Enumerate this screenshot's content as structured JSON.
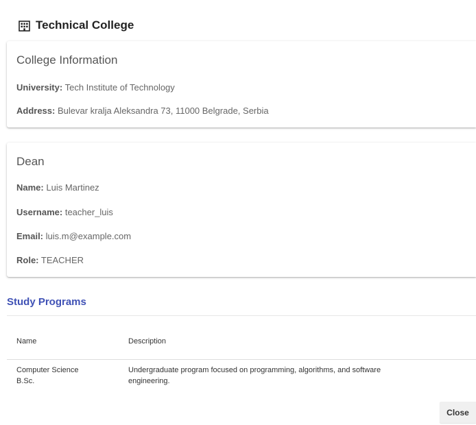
{
  "dialog": {
    "title_icon": "building-icon",
    "title": "Technical College",
    "close_label": "Close"
  },
  "college_info": {
    "heading": "College Information",
    "university_label": "University:",
    "university_value": "Tech Institute of Technology",
    "address_label": "Address:",
    "address_value": "Bulevar kralja Aleksandra 73, 11000 Belgrade, Serbia"
  },
  "dean": {
    "heading": "Dean",
    "name_label": "Name:",
    "name_value": "Luis Martinez",
    "username_label": "Username:",
    "username_value": "teacher_luis",
    "email_label": "Email:",
    "email_value": "luis.m@example.com",
    "role_label": "Role:",
    "role_value": "TEACHER"
  },
  "study_programs": {
    "heading": "Study Programs",
    "columns": [
      "Name",
      "Description"
    ],
    "rows": [
      {
        "name_line1": "Computer Science",
        "name_line2": "B.Sc.",
        "description_line1": "Undergraduate program focused on programming, algorithms, and software",
        "description_line2": "engineering."
      }
    ]
  },
  "colors": {
    "accent": "#3f51b5",
    "button_bg": "#f0f0f0"
  }
}
